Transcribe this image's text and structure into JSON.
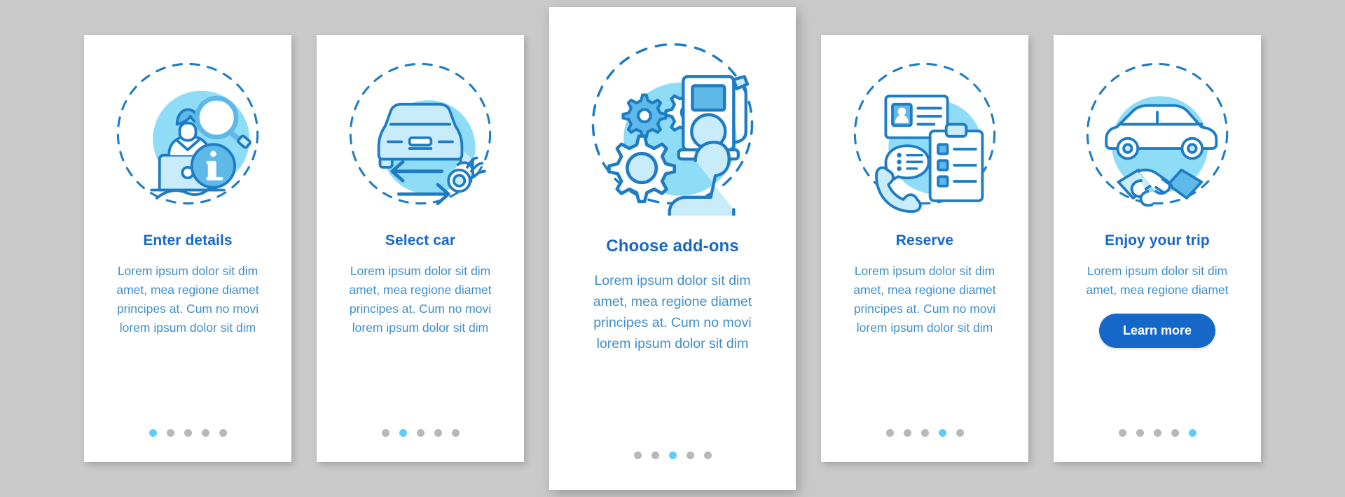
{
  "theme": {
    "page_background": "#c9c9c9",
    "card_background": "#ffffff",
    "title_color": "#1668c8",
    "body_color": "#3f8ecb",
    "accent_color": "#5ecdf5",
    "dot_inactive_color": "#b8b8b8",
    "button_background": "#1668c8",
    "button_text_color": "#ffffff",
    "illustration_stroke": "#1d7cc4",
    "illustration_blob": "#8fdcf7",
    "illustration_fill_light": "#c9ecfa",
    "illustration_fill_mid": "#5eb8e8"
  },
  "screens": [
    {
      "id": "enter-details",
      "title": "Enter details",
      "body": "Lorem ipsum dolor sit dim amet, mea regione diamet principes at. Cum no movi lorem ipsum dolor sit dim",
      "illustration_name": "person-laptop-magnifier-info-icon",
      "dots": {
        "total": 5,
        "active_index": 0
      },
      "featured": false,
      "button": null
    },
    {
      "id": "select-car",
      "title": "Select car",
      "body": "Lorem ipsum dolor sit dim amet, mea regione diamet principes at. Cum no movi lorem ipsum dolor sit dim",
      "illustration_name": "car-front-arrows-ok-hand-icon",
      "dots": {
        "total": 5,
        "active_index": 1
      },
      "featured": false,
      "button": null
    },
    {
      "id": "choose-add-ons",
      "title": "Choose add-ons",
      "body": "Lorem ipsum dolor sit dim amet, mea regione diamet principes at. Cum no movi lorem ipsum dolor sit dim",
      "illustration_name": "gears-fuel-pump-car-seat-icon",
      "dots": {
        "total": 5,
        "active_index": 2
      },
      "featured": true,
      "button": null
    },
    {
      "id": "reserve",
      "title": "Reserve",
      "body": "Lorem ipsum dolor sit dim amet, mea regione diamet principes at. Cum no movi lorem ipsum dolor sit dim",
      "illustration_name": "id-card-phone-checklist-icon",
      "dots": {
        "total": 5,
        "active_index": 3
      },
      "featured": false,
      "button": null
    },
    {
      "id": "enjoy-your-trip",
      "title": "Enjoy your trip",
      "body": "Lorem ipsum dolor sit dim amet, mea regione diamet",
      "illustration_name": "car-side-handshake-icon",
      "dots": {
        "total": 5,
        "active_index": 4
      },
      "featured": false,
      "button": {
        "label": "Learn more"
      }
    }
  ]
}
